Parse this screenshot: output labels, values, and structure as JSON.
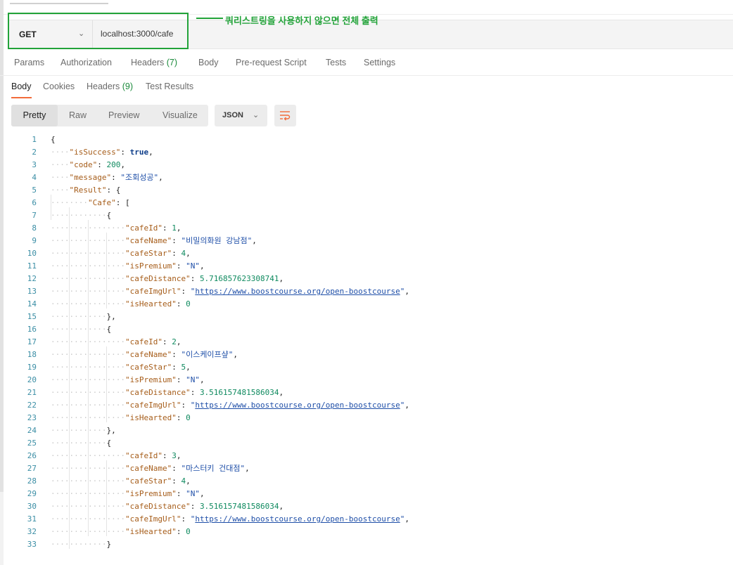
{
  "request": {
    "method": "GET",
    "url": "localhost:3000/cafe",
    "annotation": "쿼리스트링을 사용하지 않으면 전체 출력",
    "annotation_color": "#22a339"
  },
  "request_tabs": [
    {
      "label": "Params",
      "count": ""
    },
    {
      "label": "Authorization",
      "count": ""
    },
    {
      "label": "Headers",
      "count": "(7)"
    },
    {
      "label": "Body",
      "count": ""
    },
    {
      "label": "Pre-request Script",
      "count": ""
    },
    {
      "label": "Tests",
      "count": ""
    },
    {
      "label": "Settings",
      "count": ""
    }
  ],
  "response_tabs": [
    {
      "label": "Body",
      "count": "",
      "active": true
    },
    {
      "label": "Cookies",
      "count": ""
    },
    {
      "label": "Headers",
      "count": "(9)"
    },
    {
      "label": "Test Results",
      "count": ""
    }
  ],
  "view_modes": [
    "Pretty",
    "Raw",
    "Preview",
    "Visualize"
  ],
  "active_view": "Pretty",
  "format": "JSON",
  "wrap_icon": "wrap-lines-icon",
  "accent_color": "#f26b3a",
  "code_lines": [
    {
      "n": "1",
      "tokens": [
        [
          "p",
          "{"
        ]
      ]
    },
    {
      "n": "2",
      "tokens": [
        [
          "k",
          "\"isSuccess\""
        ],
        [
          "p",
          ": "
        ],
        [
          "b",
          "true"
        ],
        [
          "p",
          ","
        ]
      ]
    },
    {
      "n": "3",
      "tokens": [
        [
          "k",
          "\"code\""
        ],
        [
          "p",
          ": "
        ],
        [
          "n",
          "200"
        ],
        [
          "p",
          ","
        ]
      ]
    },
    {
      "n": "4",
      "tokens": [
        [
          "k",
          "\"message\""
        ],
        [
          "p",
          ": "
        ],
        [
          "s",
          "\"조회성공\""
        ],
        [
          "p",
          ","
        ]
      ]
    },
    {
      "n": "5",
      "tokens": [
        [
          "k",
          "\"Result\""
        ],
        [
          "p",
          ": {"
        ]
      ]
    },
    {
      "n": "6",
      "tokens": [
        [
          "k",
          "\"Cafe\""
        ],
        [
          "p",
          ": ["
        ]
      ]
    },
    {
      "n": "7",
      "tokens": [
        [
          "p",
          "{"
        ]
      ]
    },
    {
      "n": "8",
      "tokens": [
        [
          "k",
          "\"cafeId\""
        ],
        [
          "p",
          ": "
        ],
        [
          "n",
          "1"
        ],
        [
          "p",
          ","
        ]
      ]
    },
    {
      "n": "9",
      "tokens": [
        [
          "k",
          "\"cafeName\""
        ],
        [
          "p",
          ": "
        ],
        [
          "s",
          "\"비밀의화원 강남점\""
        ],
        [
          "p",
          ","
        ]
      ]
    },
    {
      "n": "10",
      "tokens": [
        [
          "k",
          "\"cafeStar\""
        ],
        [
          "p",
          ": "
        ],
        [
          "n",
          "4"
        ],
        [
          "p",
          ","
        ]
      ]
    },
    {
      "n": "11",
      "tokens": [
        [
          "k",
          "\"isPremium\""
        ],
        [
          "p",
          ": "
        ],
        [
          "s",
          "\"N\""
        ],
        [
          "p",
          ","
        ]
      ]
    },
    {
      "n": "12",
      "tokens": [
        [
          "k",
          "\"cafeDistance\""
        ],
        [
          "p",
          ": "
        ],
        [
          "n",
          "5.716857623308741"
        ],
        [
          "p",
          ","
        ]
      ]
    },
    {
      "n": "13",
      "tokens": [
        [
          "k",
          "\"cafeImgUrl\""
        ],
        [
          "p",
          ": "
        ],
        [
          "s",
          "\""
        ],
        [
          "u",
          "https://www.boostcourse.org/open-boostcourse"
        ],
        [
          "s",
          "\""
        ],
        [
          "p",
          ","
        ]
      ]
    },
    {
      "n": "14",
      "tokens": [
        [
          "k",
          "\"isHearted\""
        ],
        [
          "p",
          ": "
        ],
        [
          "n",
          "0"
        ]
      ]
    },
    {
      "n": "15",
      "tokens": [
        [
          "p",
          "},"
        ]
      ]
    },
    {
      "n": "16",
      "tokens": [
        [
          "p",
          "{"
        ]
      ]
    },
    {
      "n": "17",
      "tokens": [
        [
          "k",
          "\"cafeId\""
        ],
        [
          "p",
          ": "
        ],
        [
          "n",
          "2"
        ],
        [
          "p",
          ","
        ]
      ]
    },
    {
      "n": "18",
      "tokens": [
        [
          "k",
          "\"cafeName\""
        ],
        [
          "p",
          ": "
        ],
        [
          "s",
          "\"이스케이프샾\""
        ],
        [
          "p",
          ","
        ]
      ]
    },
    {
      "n": "19",
      "tokens": [
        [
          "k",
          "\"cafeStar\""
        ],
        [
          "p",
          ": "
        ],
        [
          "n",
          "5"
        ],
        [
          "p",
          ","
        ]
      ]
    },
    {
      "n": "20",
      "tokens": [
        [
          "k",
          "\"isPremium\""
        ],
        [
          "p",
          ": "
        ],
        [
          "s",
          "\"N\""
        ],
        [
          "p",
          ","
        ]
      ]
    },
    {
      "n": "21",
      "tokens": [
        [
          "k",
          "\"cafeDistance\""
        ],
        [
          "p",
          ": "
        ],
        [
          "n",
          "3.516157481586034"
        ],
        [
          "p",
          ","
        ]
      ]
    },
    {
      "n": "22",
      "tokens": [
        [
          "k",
          "\"cafeImgUrl\""
        ],
        [
          "p",
          ": "
        ],
        [
          "s",
          "\""
        ],
        [
          "u",
          "https://www.boostcourse.org/open-boostcourse"
        ],
        [
          "s",
          "\""
        ],
        [
          "p",
          ","
        ]
      ]
    },
    {
      "n": "23",
      "tokens": [
        [
          "k",
          "\"isHearted\""
        ],
        [
          "p",
          ": "
        ],
        [
          "n",
          "0"
        ]
      ]
    },
    {
      "n": "24",
      "tokens": [
        [
          "p",
          "},"
        ]
      ]
    },
    {
      "n": "25",
      "tokens": [
        [
          "p",
          "{"
        ]
      ]
    },
    {
      "n": "26",
      "tokens": [
        [
          "k",
          "\"cafeId\""
        ],
        [
          "p",
          ": "
        ],
        [
          "n",
          "3"
        ],
        [
          "p",
          ","
        ]
      ]
    },
    {
      "n": "27",
      "tokens": [
        [
          "k",
          "\"cafeName\""
        ],
        [
          "p",
          ": "
        ],
        [
          "s",
          "\"마스터키 건대점\""
        ],
        [
          "p",
          ","
        ]
      ]
    },
    {
      "n": "28",
      "tokens": [
        [
          "k",
          "\"cafeStar\""
        ],
        [
          "p",
          ": "
        ],
        [
          "n",
          "4"
        ],
        [
          "p",
          ","
        ]
      ]
    },
    {
      "n": "29",
      "tokens": [
        [
          "k",
          "\"isPremium\""
        ],
        [
          "p",
          ": "
        ],
        [
          "s",
          "\"N\""
        ],
        [
          "p",
          ","
        ]
      ]
    },
    {
      "n": "30",
      "tokens": [
        [
          "k",
          "\"cafeDistance\""
        ],
        [
          "p",
          ": "
        ],
        [
          "n",
          "3.516157481586034"
        ],
        [
          "p",
          ","
        ]
      ]
    },
    {
      "n": "31",
      "tokens": [
        [
          "k",
          "\"cafeImgUrl\""
        ],
        [
          "p",
          ": "
        ],
        [
          "s",
          "\""
        ],
        [
          "u",
          "https://www.boostcourse.org/open-boostcourse"
        ],
        [
          "s",
          "\""
        ],
        [
          "p",
          ","
        ]
      ]
    },
    {
      "n": "32",
      "tokens": [
        [
          "k",
          "\"isHearted\""
        ],
        [
          "p",
          ": "
        ],
        [
          "n",
          "0"
        ]
      ]
    },
    {
      "n": "33",
      "tokens": [
        [
          "p",
          "}"
        ]
      ]
    }
  ]
}
